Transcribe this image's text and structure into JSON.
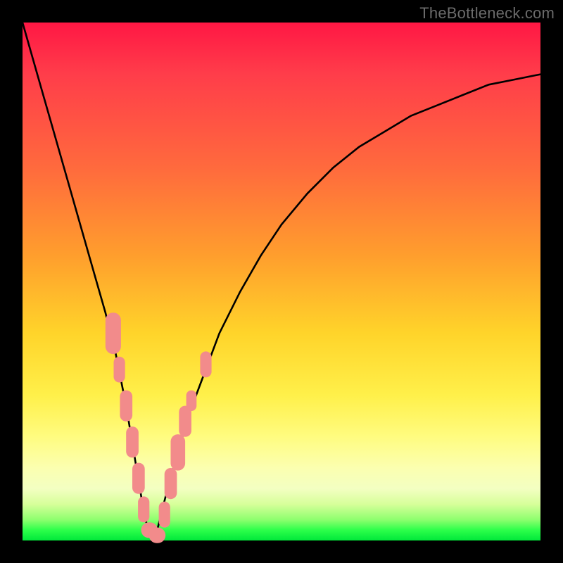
{
  "watermark": "TheBottleneck.com",
  "chart_data": {
    "type": "line",
    "title": "",
    "xlabel": "",
    "ylabel": "",
    "xlim": [
      0,
      100
    ],
    "ylim": [
      0,
      100
    ],
    "grid": false,
    "legend": false,
    "series": [
      {
        "name": "bottleneck-curve",
        "x": [
          0,
          2,
          4,
          6,
          8,
          10,
          12,
          14,
          16,
          18,
          20,
          21,
          22,
          23,
          24,
          25,
          26,
          27,
          28,
          30,
          32,
          35,
          38,
          42,
          46,
          50,
          55,
          60,
          65,
          70,
          75,
          80,
          85,
          90,
          95,
          100
        ],
        "y": [
          100,
          93,
          86,
          79,
          72,
          65,
          58,
          51,
          44,
          36,
          26,
          20,
          14,
          8,
          3,
          0,
          2,
          6,
          10,
          17,
          24,
          32,
          40,
          48,
          55,
          61,
          67,
          72,
          76,
          79,
          82,
          84,
          86,
          88,
          89,
          90
        ]
      }
    ],
    "markers": {
      "name": "highlighted-points",
      "color": "#f28b8b",
      "shape": "rounded-rect",
      "points": [
        {
          "x": 17.5,
          "y": 40,
          "w": 3.0,
          "h": 8
        },
        {
          "x": 18.7,
          "y": 33,
          "w": 2.2,
          "h": 5
        },
        {
          "x": 20.0,
          "y": 26,
          "w": 2.4,
          "h": 6
        },
        {
          "x": 21.2,
          "y": 19,
          "w": 2.4,
          "h": 6
        },
        {
          "x": 22.4,
          "y": 12,
          "w": 2.4,
          "h": 6
        },
        {
          "x": 23.4,
          "y": 6,
          "w": 2.2,
          "h": 5
        },
        {
          "x": 24.5,
          "y": 2,
          "w": 3.2,
          "h": 3
        },
        {
          "x": 26.0,
          "y": 1,
          "w": 3.2,
          "h": 3
        },
        {
          "x": 27.4,
          "y": 5,
          "w": 2.2,
          "h": 5
        },
        {
          "x": 28.6,
          "y": 11,
          "w": 2.4,
          "h": 6
        },
        {
          "x": 30.0,
          "y": 17,
          "w": 2.8,
          "h": 7
        },
        {
          "x": 31.4,
          "y": 23,
          "w": 2.4,
          "h": 6
        },
        {
          "x": 32.6,
          "y": 27,
          "w": 2.0,
          "h": 4
        },
        {
          "x": 35.4,
          "y": 34,
          "w": 2.2,
          "h": 5
        }
      ]
    },
    "background_gradient": {
      "direction": "vertical",
      "stops": [
        {
          "pos": 0.0,
          "color": "#ff1744"
        },
        {
          "pos": 0.45,
          "color": "#ff9e2d"
        },
        {
          "pos": 0.75,
          "color": "#fff04a"
        },
        {
          "pos": 0.92,
          "color": "#e8ffb0"
        },
        {
          "pos": 1.0,
          "color": "#00e83a"
        }
      ]
    }
  }
}
